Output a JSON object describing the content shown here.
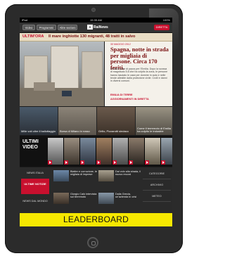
{
  "status_bar": {
    "carrier": "iPad",
    "time": "15:35 AM",
    "battery": "100%"
  },
  "nav": {
    "btn1": "Video",
    "btn2": "Programmi",
    "btn3": "Altre sezioni",
    "logo": "RaiNews",
    "live": "DIRETTA"
  },
  "ticker": {
    "tag": "ULTIM'ORA",
    "text": "Il mare inghiotte 130 migranti, 48 tratti in salvo"
  },
  "lead": {
    "date": "30 MAGGIO 2012",
    "headline": "Spagna, notte in strada per migliaia di persone. Circa 170 feriti.",
    "body": "Un'altra notte di paura per l'Emilia. Dopo la scossa di magnitudo 5.8 che ha colpito la zona, le persone hanno lasciato le case per dormire in auto e nelle tende allestite dalla protezione civile. Crolli e danni in diversi comuni.",
    "related1": "EMILIA DI TERRE",
    "related2": "AGGIORNAMENTI IN DIRETTA"
  },
  "thumbs": [
    {
      "caption": "Mille voti oltre il ballottaggio"
    },
    {
      "caption": "Borsa di Milano in rosso"
    },
    {
      "caption": "Grillo, Pizzarotti sindaco"
    },
    {
      "caption": "Come il terremoto di Emilia ha colpito le industrie"
    }
  ],
  "videos": {
    "label": "ULTIMI VIDEO"
  },
  "bottom": {
    "left_label": "NEWS ITALIA",
    "red_label": "ULTIME NOTIZIE",
    "left_label2": "NEWS DAL MONDO",
    "items": [
      {
        "text": "Blatter e corruzione, le migliaia di imprese"
      },
      {
        "text": "Dal volo alla strada, il nuovo record"
      },
      {
        "text": "Giorgio Calò intervista sul terremoto"
      },
      {
        "text": "Dalla Grecia, un'azienda in crisi"
      }
    ],
    "right1": "CATEGORIE",
    "right2": "ARCHIVIO",
    "right3": "METEO"
  },
  "leaderboard": {
    "label": "LEADERBOARD"
  }
}
